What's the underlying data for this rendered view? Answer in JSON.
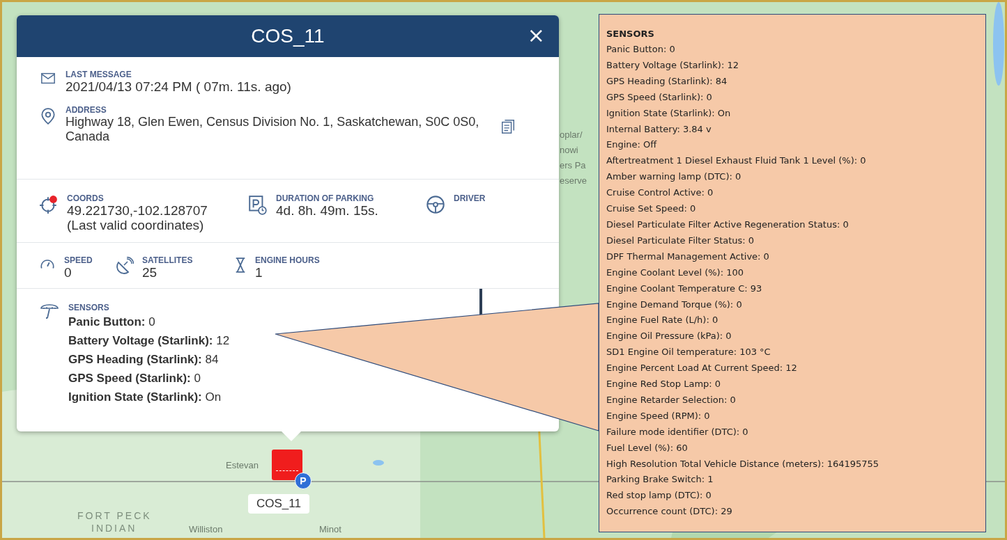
{
  "map": {
    "labels": [
      {
        "text": "oplar/"
      },
      {
        "text": "nowi"
      },
      {
        "text": "ers Pa"
      },
      {
        "text": "eserve"
      },
      {
        "text": "Estevan"
      },
      {
        "text": "FORT PECK"
      },
      {
        "text": "INDIAN"
      },
      {
        "text": "Williston"
      },
      {
        "text": "Minot"
      }
    ],
    "marker": {
      "badge": "P",
      "label": "COS_11"
    }
  },
  "popup": {
    "title": "COS_11",
    "close": "×",
    "last_message": {
      "label": "LAST MESSAGE",
      "value": "2021/04/13 07:24 PM  ( 07m. 11s. ago)"
    },
    "address": {
      "label": "ADDRESS",
      "value": "Highway 18, Glen Ewen, Census Division No. 1, Saskatchewan, S0C 0S0, Canada"
    },
    "coords": {
      "label": "COORDS",
      "value": "49.221730,-102.128707",
      "note": "(Last valid coordinates)",
      "warning": true
    },
    "parking": {
      "label": "DURATION OF PARKING",
      "value": "4d. 8h. 49m. 15s."
    },
    "driver": {
      "label": "DRIVER"
    },
    "speed": {
      "label": "SPEED",
      "value": "0"
    },
    "satellites": {
      "label": "SATELLITES",
      "value": "25"
    },
    "engine_hours": {
      "label": "ENGINE HOURS",
      "value": "1"
    },
    "sensors": {
      "label": "SENSORS",
      "items": [
        {
          "label": "Panic Button:",
          "value": "0"
        },
        {
          "label": "Battery Voltage (Starlink):",
          "value": "12"
        },
        {
          "label": "GPS Heading (Starlink):",
          "value": "84"
        },
        {
          "label": "GPS Speed (Starlink):",
          "value": "0"
        },
        {
          "label": "Ignition State (Starlink):",
          "value": "On"
        }
      ]
    }
  },
  "callout": {
    "title": "SENSORS",
    "lines": [
      "Panic Button: 0",
      "Battery Voltage (Starlink): 12",
      "GPS Heading (Starlink): 84",
      "GPS Speed (Starlink): 0",
      "Ignition State (Starlink): On",
      "Internal Battery: 3.84 v",
      "Engine: Off",
      "Aftertreatment 1 Diesel Exhaust Fluid Tank 1 Level (%): 0",
      "Amber warning lamp (DTC): 0",
      "Cruise Control Active: 0",
      "Cruise Set Speed: 0",
      "Diesel Particulate Filter Active Regeneration Status: 0",
      "Diesel Particulate Filter Status: 0",
      "DPF Thermal Management Active: 0",
      "Engine Coolant Level (%): 100",
      "Engine Coolant Temperature C: 93",
      "Engine Demand Torque (%): 0",
      "Engine Fuel Rate (L/h): 0",
      "Engine Oil Pressure (kPa): 0",
      "SD1 Engine Oil temperature: 103 °C",
      "Engine Percent Load At Current Speed: 12",
      "Engine Red Stop Lamp: 0",
      "Engine Retarder Selection: 0",
      "Engine Speed (RPM): 0",
      "Failure mode identifier (DTC): 0",
      "Fuel Level (%): 60",
      "High Resolution Total Vehicle Distance (meters): 164195755",
      "Parking Brake Switch: 1",
      "Red stop lamp (DTC): 0",
      "Occurrence count (DTC): 29"
    ]
  }
}
